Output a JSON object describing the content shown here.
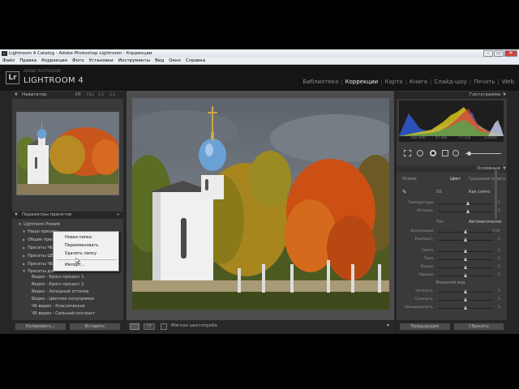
{
  "window": {
    "title": "Lightroom 4 Catalog - Adobe Photoshop Lightroom - Коррекции",
    "icon": "Lr",
    "buttons": [
      "–",
      "▭",
      "✕"
    ]
  },
  "menu": [
    "Файл",
    "Правка",
    "Коррекции",
    "Фото",
    "Установки",
    "Инструменты",
    "Вид",
    "Окно",
    "Справка"
  ],
  "identity": {
    "logo": "Lr",
    "sub": "ADOBE PHOTOSHOP",
    "product": "LIGHTROOM 4"
  },
  "modules": [
    {
      "label": "Библиотека",
      "active": false
    },
    {
      "label": "Коррекции",
      "active": true
    },
    {
      "label": "Карта",
      "active": false
    },
    {
      "label": "Книга",
      "active": false
    },
    {
      "label": "Слайд-шоу",
      "active": false
    },
    {
      "label": "Печать",
      "active": false
    },
    {
      "label": "Web",
      "active": false
    }
  ],
  "left": {
    "navigator": {
      "title": "Навигатор",
      "zoom": [
        "FIT",
        "FILL",
        "1:1",
        "3:1"
      ]
    },
    "presets": {
      "title": "Параметры пресетов",
      "items": [
        "Lightroom Presets",
        "Наши пресеты",
        "Общие пресеты",
        "Пресеты ЧБ",
        "Пресеты ЦВ",
        "Пресеты ЧБ",
        "Пресеты для",
        "Видео - Кросс-процесс 1",
        "Видео - Кросс-процесс 2",
        "Видео - Холодный оттенок",
        "Видео - Цветное полупрямое",
        "ЧБ видео - Классическая",
        "ЧБ видео - Сильный контраст"
      ]
    },
    "context_menu": [
      "Новая папка",
      "Переименовать",
      "Удалить папку",
      "Импорт..."
    ],
    "buttons": {
      "copy": "Копировать...",
      "paste": "Вставить"
    }
  },
  "toolbar": {
    "softproof": "Мягкая цветопроба"
  },
  "right": {
    "histogram": {
      "title": "Гистограмма",
      "iso": "ISO 400",
      "focal": "47 мм",
      "aperture": "f / 5,6",
      "shutter": "1/2000"
    },
    "basic": {
      "title": "Основные",
      "treatment": "Режим",
      "color": "Цвет",
      "bw": "Градации серого"
    },
    "wb": {
      "label": "ББ",
      "value": "Как снято"
    },
    "tone": {
      "label": "Тон",
      "auto": "Автоматически"
    },
    "presence": {
      "label": "Внешний вид"
    },
    "sliders": [
      {
        "label": "Температура",
        "value": "0",
        "pos": 0.55
      },
      {
        "label": "Оттенок",
        "value": "0",
        "pos": 0.55
      },
      {
        "label": "Экспозиция",
        "value": "0,00",
        "pos": 0.5
      },
      {
        "label": "Контраст",
        "value": "0",
        "pos": 0.5
      },
      {
        "label": "Света",
        "value": "0",
        "pos": 0.5
      },
      {
        "label": "Тени",
        "value": "0",
        "pos": 0.5
      },
      {
        "label": "Белые",
        "value": "0",
        "pos": 0.5
      },
      {
        "label": "Чёрные",
        "value": "0",
        "pos": 0.5
      },
      {
        "label": "Четкость",
        "value": "0",
        "pos": 0.5
      },
      {
        "label": "Сочность",
        "value": "0",
        "pos": 0.5
      },
      {
        "label": "Насыщенность",
        "value": "0",
        "pos": 0.5
      }
    ],
    "buttons": {
      "previous": "Предыдущее",
      "reset": "Сбросить"
    }
  }
}
